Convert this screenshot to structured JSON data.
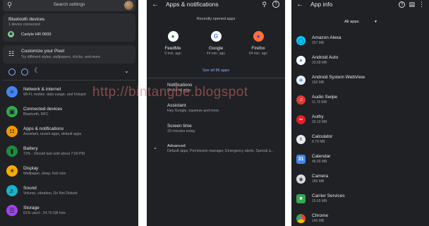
{
  "settings": {
    "search_placeholder": "Search settings",
    "bluetooth_card": {
      "title": "Bluetooth devices",
      "subtitle": "1 device connected",
      "device": "Carlyle HR 0933"
    },
    "customize_card": {
      "title": "Customize your Pixel",
      "subtitle": "Try different styles, wallpapers, clocks, and more"
    },
    "items": [
      {
        "title": "Network & internet",
        "subtitle": "Wi-Fi, mobile, data usage, and hotspot",
        "icon": "wifi-icon",
        "color": "#4285f4"
      },
      {
        "title": "Connected devices",
        "subtitle": "Bluetooth, NFC",
        "icon": "devices-icon",
        "color": "#34a853"
      },
      {
        "title": "Apps & notifications",
        "subtitle": "Assistant, recent apps, default apps",
        "icon": "apps-icon",
        "color": "#f29900"
      },
      {
        "title": "Battery",
        "subtitle": "72% - Should last until about 7:00 PM",
        "icon": "battery-icon",
        "color": "#1e8e3e"
      },
      {
        "title": "Display",
        "subtitle": "Wallpaper, sleep, font size",
        "icon": "display-icon",
        "color": "#f9ab00"
      },
      {
        "title": "Sound",
        "subtitle": "Volume, vibration, Do Not Disturb",
        "icon": "sound-icon",
        "color": "#12b5cb"
      },
      {
        "title": "Storage",
        "subtitle": "61% used - 24.70 GB free",
        "icon": "storage-icon",
        "color": "#a142f4"
      }
    ]
  },
  "apps_notifications": {
    "title": "Apps & notifications",
    "recent_label": "Recently opened apps",
    "recent_apps": [
      {
        "name": "FeedMe",
        "time": "0 min. ago",
        "color": "#1e8e3e"
      },
      {
        "name": "Google",
        "time": "44 min. ago",
        "color": "#ffffff"
      },
      {
        "name": "Firefox",
        "time": "64 min. ago",
        "color": "#ff7139"
      }
    ],
    "see_all": "See all 96 apps",
    "options": [
      {
        "title": "Notifications",
        "subtitle": "On for all apps"
      },
      {
        "title": "Assistant",
        "subtitle": "Hey Google, squeeze and more"
      },
      {
        "title": "Screen time",
        "subtitle": "33 minutes today"
      },
      {
        "title": "Advanced",
        "subtitle": "Default apps, Permission manager, Emergency alerts, Special a..."
      }
    ]
  },
  "app_info": {
    "title": "App info",
    "filter": "All apps",
    "apps": [
      {
        "name": "Amazon Alexa",
        "size": "257 MB",
        "color": "#00caff"
      },
      {
        "name": "Android Auto",
        "size": "33.68 MB",
        "color": "#4285f4"
      },
      {
        "name": "Android System WebView",
        "size": "166 MB",
        "color": "#4285f4"
      },
      {
        "name": "Audio Swipe",
        "size": "11.76 MB",
        "color": "#e53935"
      },
      {
        "name": "Authy",
        "size": "30.19 MB",
        "color": "#ec1c24"
      },
      {
        "name": "Calculator",
        "size": "8.79 MB",
        "color": "#8ab4f8"
      },
      {
        "name": "Calendar",
        "size": "48.90 MB",
        "color": "#4285f4"
      },
      {
        "name": "Camera",
        "size": "189 MB",
        "color": "#9aa0a6"
      },
      {
        "name": "Carrier Services",
        "size": "15.55 MB",
        "color": "#34a853"
      },
      {
        "name": "Chrome",
        "size": "145 MB",
        "color": "#fbbc04"
      }
    ]
  },
  "watermark": "http://bintangbe.blogspot"
}
